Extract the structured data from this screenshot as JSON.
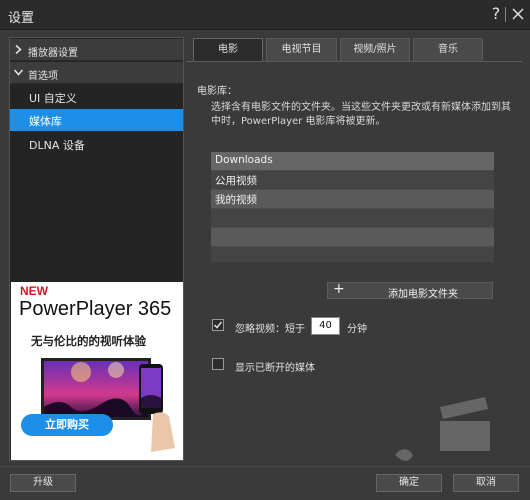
{
  "window": {
    "title": "设置",
    "help": "?"
  },
  "nav": {
    "groups": [
      {
        "label": "播放器设置",
        "expanded": false
      },
      {
        "label": "首选项",
        "expanded": true
      }
    ],
    "items": [
      "UI 自定义",
      "媒体库",
      "DLNA 设备"
    ],
    "active_item": "媒体库"
  },
  "ad": {
    "new_label": "NEW",
    "product": "PowerPlayer 365",
    "tagline": "无与伦比的的视听体验",
    "buy_label": "立即购买"
  },
  "tabs": [
    {
      "label": "电影",
      "active": true
    },
    {
      "label": "电视节目",
      "active": false
    },
    {
      "label": "视频/照片",
      "active": false
    },
    {
      "label": "音乐",
      "active": false
    }
  ],
  "library": {
    "title": "电影库：",
    "description": "选择含有电影文件的文件夹。当这些文件夹更改或有新媒体添加到其中时，PowerPlayer 电影库将被更新。",
    "folders": [
      "Downloads",
      "公用视频",
      "我的视频"
    ],
    "add_folder_label": "添加电影文件夹"
  },
  "options": {
    "ignore_video": {
      "label": "忽略视频：短于",
      "checked": true,
      "value": "40",
      "unit": "分钟"
    },
    "show_disconnected": {
      "label": "显示已断开的媒体",
      "checked": false
    }
  },
  "footer": {
    "upgrade": "升级",
    "ok": "确定",
    "cancel": "取消"
  },
  "colors": {
    "accent": "#1e8fe8",
    "background": "#3a3a3a",
    "panel": "#242424"
  }
}
